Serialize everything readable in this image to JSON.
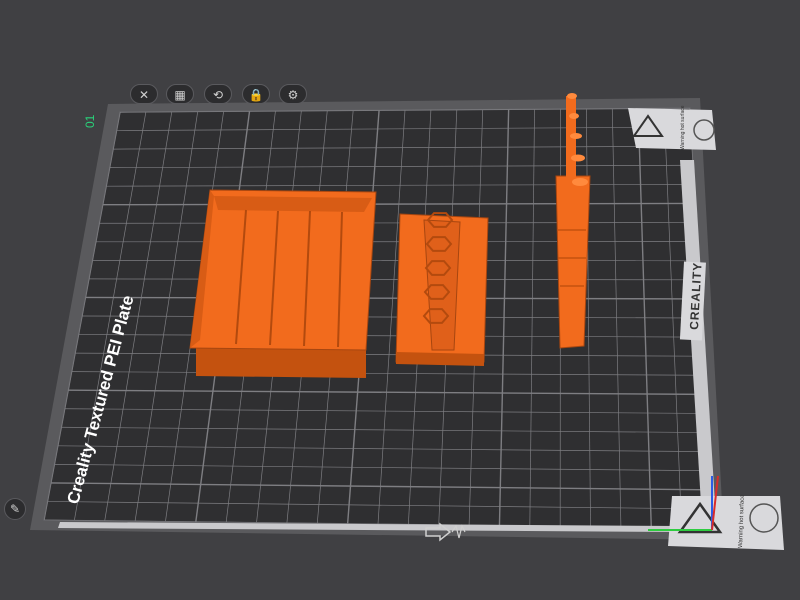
{
  "toolbar": {
    "buttons": [
      {
        "name": "delete-plate-button",
        "glyph": "✕"
      },
      {
        "name": "arrange-button",
        "glyph": "▦"
      },
      {
        "name": "orient-button",
        "glyph": "⟲"
      },
      {
        "name": "lock-plate-button",
        "glyph": "🔒"
      },
      {
        "name": "plate-settings-button",
        "glyph": "⚙"
      }
    ]
  },
  "plate": {
    "number": "01",
    "name": "Creality Textured PEI Plate",
    "brand": "CREALITY",
    "warning_top": "Warning hot surface",
    "warning_bottom": "Warning hot surface"
  },
  "colors": {
    "background": "#404043",
    "plate": "#2f2f31",
    "grid": "#8a8a8e",
    "model": "#f26b1d",
    "model_shadow": "#c4520f",
    "plate_number": "#29d37a"
  },
  "edit_button": {
    "glyph": "✎"
  }
}
